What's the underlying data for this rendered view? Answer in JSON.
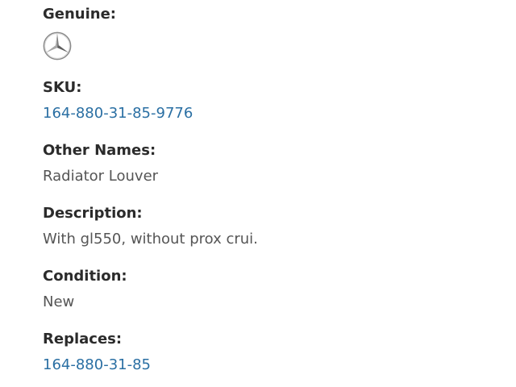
{
  "genuine": {
    "label": "Genuine:",
    "logo_icon": "three-pointed-star-logo"
  },
  "sku": {
    "label": "SKU:",
    "value": "164-880-31-85-9776"
  },
  "other_names": {
    "label": "Other Names:",
    "value": "Radiator Louver"
  },
  "description": {
    "label": "Description:",
    "value": "With gl550, without prox crui."
  },
  "condition": {
    "label": "Condition:",
    "value": "New"
  },
  "replaces": {
    "label": "Replaces:",
    "value": "164-880-31-85"
  },
  "colors": {
    "label": "#2b2b2b",
    "value": "#555555",
    "link": "#2a6fa3"
  }
}
